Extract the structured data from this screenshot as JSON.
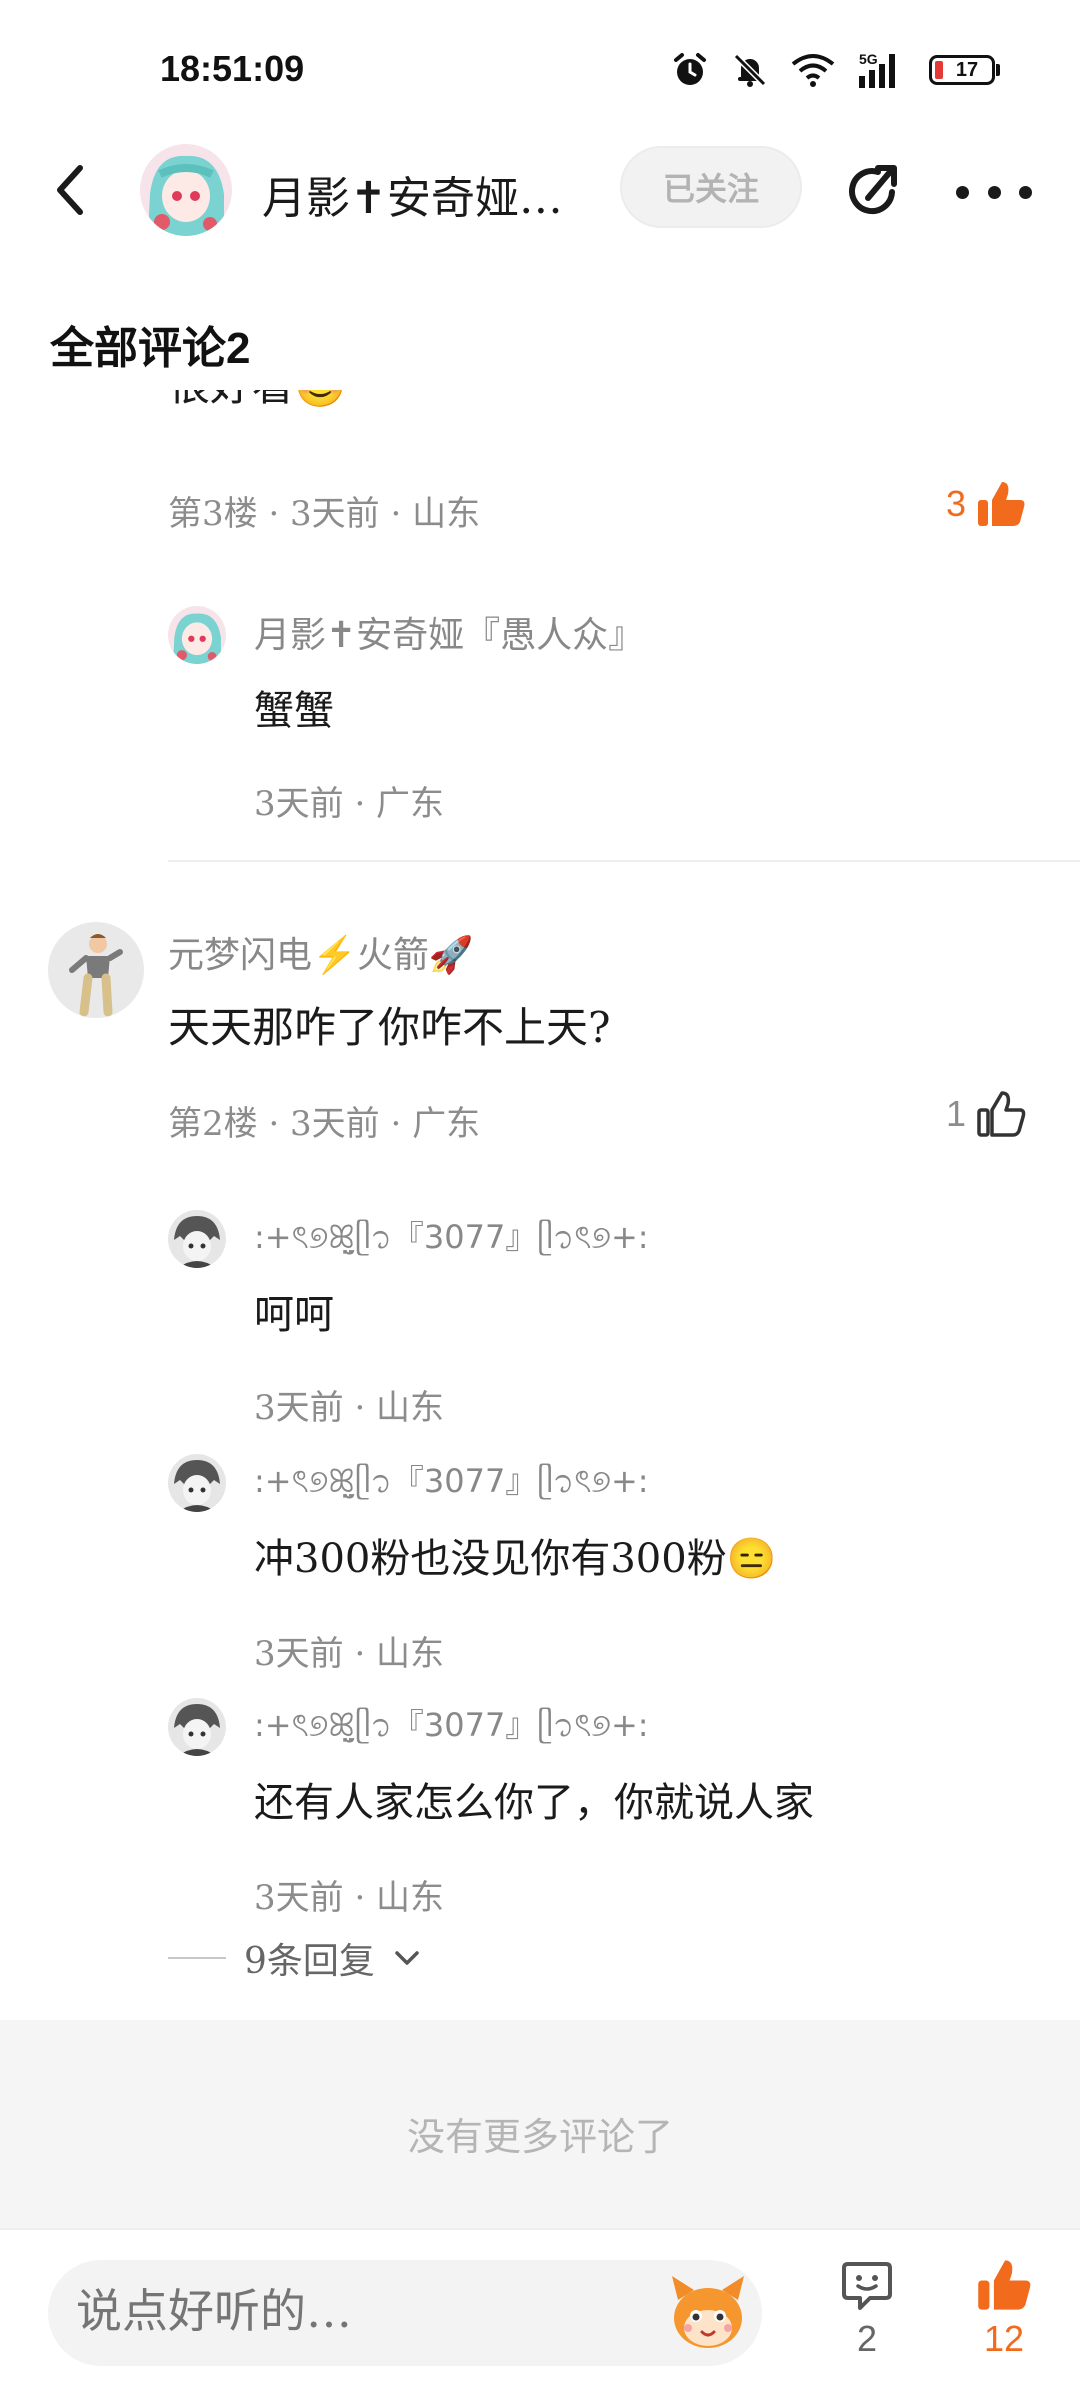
{
  "status": {
    "time": "18:51:09",
    "battery": "17",
    "network": "5G"
  },
  "header": {
    "name": "月影✝安奇娅…",
    "follow_label": "已关注"
  },
  "section": {
    "title": "全部评论2"
  },
  "comments": [
    {
      "partial_text": "很好看😊",
      "meta": "第3楼 · 3天前 · 山东",
      "likes": "3",
      "liked": true,
      "replies": [
        {
          "name": "月影✝安奇娅『愚人众』",
          "text": "蟹蟹",
          "meta": "3天前 · 广东"
        }
      ]
    },
    {
      "name": "元梦闪电⚡火箭🚀",
      "text": "天天那咋了你咋不上天?",
      "meta": "第2楼 · 3天前 · 广东",
      "likes": "1",
      "liked": false,
      "replies": [
        {
          "name": ":+ৎ୭ꕤ̤̮ᥫ᭡『3077』ᥫ᭡ৎ୭+:",
          "text": "呵呵",
          "meta": "3天前 · 山东"
        },
        {
          "name": ":+ৎ୭ꕤ̤̮ᥫ᭡『3077』ᥫ᭡ৎ୭+:",
          "text": "冲300粉也没见你有300粉😑",
          "meta": "3天前 · 山东"
        },
        {
          "name": ":+ৎ୭ꕤ̤̮ᥫ᭡『3077』ᥫ᭡ৎ୭+:",
          "text": "还有人家怎么你了，你就说人家",
          "meta": "3天前 · 山东"
        }
      ],
      "more_replies": "9条回复"
    }
  ],
  "footer": {
    "no_more": "没有更多评论了"
  },
  "bottom_bar": {
    "input_placeholder": "说点好听的…",
    "comment_count": "2",
    "like_count": "12"
  },
  "colors": {
    "accent": "#f26b1d",
    "muted": "#8c8c8c",
    "follow_bg": "#f2f2f2"
  }
}
